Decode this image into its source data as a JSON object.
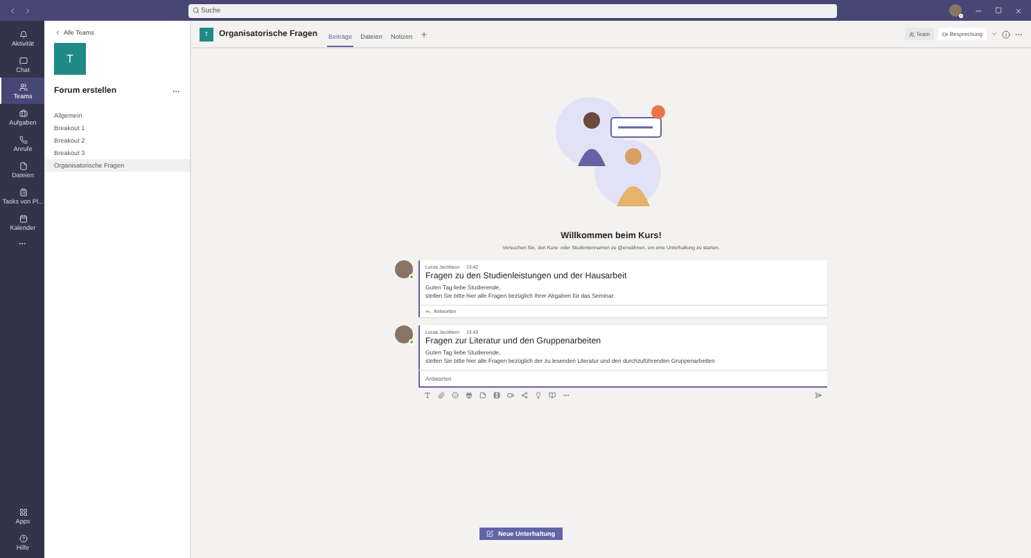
{
  "window": {
    "search_placeholder": "Suche"
  },
  "rail": {
    "items": [
      {
        "label": "Aktivität",
        "selected": false
      },
      {
        "label": "Chat",
        "selected": false
      },
      {
        "label": "Teams",
        "selected": true
      },
      {
        "label": "Aufgaben",
        "selected": false
      },
      {
        "label": "Anrufe",
        "selected": false
      },
      {
        "label": "Dateien",
        "selected": false
      },
      {
        "label": "Tasks von Pl...",
        "selected": false
      },
      {
        "label": "Kalender",
        "selected": false
      }
    ],
    "bottom_items": [
      {
        "label": "Apps",
        "selected": false
      },
      {
        "label": "Hilfe",
        "selected": false
      }
    ]
  },
  "sidebar": {
    "back_link": "Alle Teams",
    "team_initial": "T",
    "team_name": "Forum erstellen",
    "channels": [
      {
        "label": "Allgemein",
        "selected": false
      },
      {
        "label": "Breakout 1",
        "selected": false
      },
      {
        "label": "Breakout 2",
        "selected": false
      },
      {
        "label": "Breakout 3",
        "selected": false
      },
      {
        "label": "Organisatorische Fragen",
        "selected": true
      }
    ]
  },
  "channel_header": {
    "initial": "T",
    "title": "Organisatorische Fragen",
    "tabs": [
      {
        "label": "Beiträge",
        "selected": true
      },
      {
        "label": "Dateien",
        "selected": false
      },
      {
        "label": "Notizen",
        "selected": false
      }
    ],
    "team_button": "Team",
    "meeting_button": "Besprechung"
  },
  "welcome": {
    "title": "Willkommen beim Kurs!",
    "subtitle": "Versuchen Sie, den Kurs- oder Studentennamen zu @erwähnen, um eine Unterhaltung zu starten."
  },
  "posts": [
    {
      "author": "Lucas Jacobsen",
      "time": "13:42",
      "title": "Fragen zu den Studienleistungen und der Hausarbeit",
      "lines": [
        "Guten Tag liebe Studierende,",
        "stellen Sie bitte hier alle Fragen bezüglich Ihrer Abgaben für das Seminar."
      ],
      "reply": {
        "kind": "link",
        "text": "Antworten"
      }
    },
    {
      "author": "Lucas Jacobsen",
      "time": "13:43",
      "title": "Fragen zur Literatur und den Gruppenarbeiten",
      "lines": [
        "Guten Tag liebe Studierende,",
        "stellen Sie bitte hier alle Fragen bezüglich der zu lesenden Literatur und den durchzuführenden Gruppenarbeiten"
      ],
      "reply": {
        "kind": "field",
        "placeholder": "Antworten"
      }
    }
  ],
  "new_conversation_button": "Neue Unterhaltung"
}
